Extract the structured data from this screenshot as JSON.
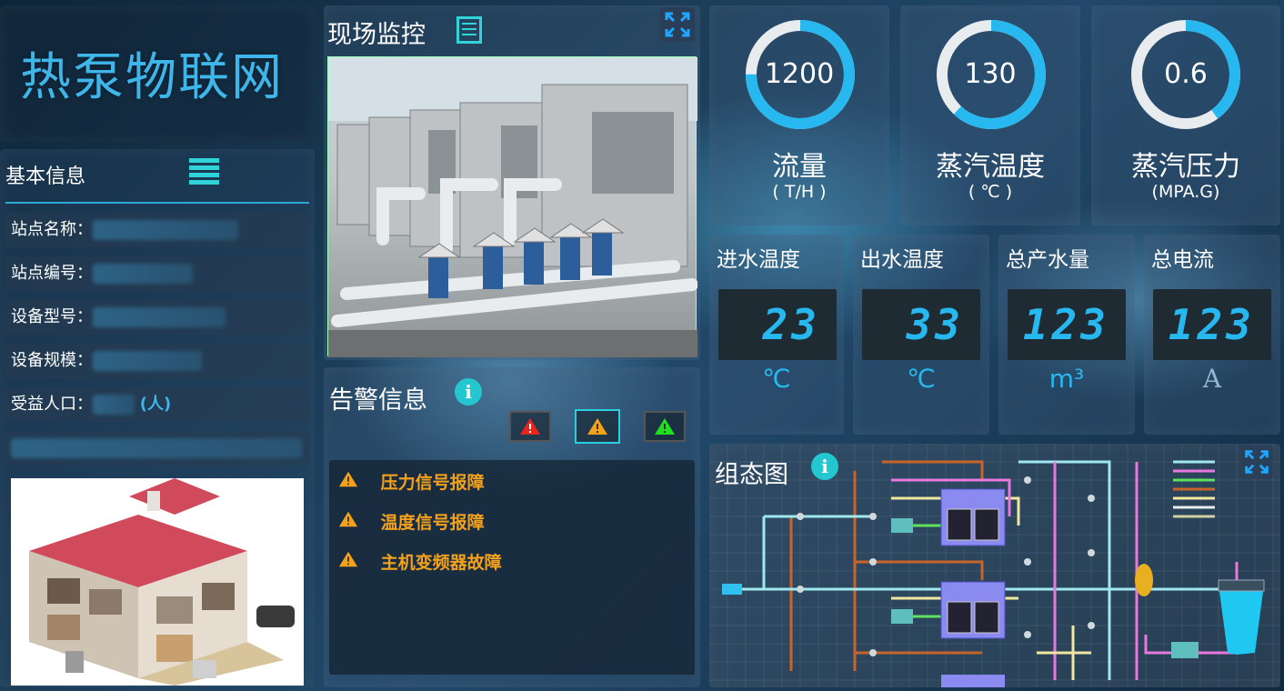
{
  "app_title": "热泵物联网",
  "basic_info": {
    "title": "基本信息",
    "rows": [
      {
        "label": "站点名称："
      },
      {
        "label": "站点编号："
      },
      {
        "label": "设备型号："
      },
      {
        "label": "设备规模："
      },
      {
        "label": "受益人口：",
        "suffix": "(人)"
      }
    ]
  },
  "monitor": {
    "title": "现场监控"
  },
  "alarm": {
    "title": "告警信息",
    "items": [
      "压力信号报障",
      "温度信号报障",
      "主机变频器故障"
    ],
    "colors": {
      "red": "#e8251c",
      "orange": "#f4a11b",
      "green": "#1ee01e"
    }
  },
  "gauges": [
    {
      "value": "1200",
      "label": "流量",
      "unit": "( T/H )",
      "fraction": 0.75
    },
    {
      "value": "130",
      "label": "蒸汽温度",
      "unit": "( ℃ )",
      "fraction": 0.62
    },
    {
      "value": "0.6",
      "label": "蒸汽压力",
      "unit": "(MPA.G)",
      "fraction": 0.4
    }
  ],
  "metrics": [
    {
      "title": "进水温度",
      "value": "23",
      "unit": "℃"
    },
    {
      "title": "出水温度",
      "value": "33",
      "unit": "℃"
    },
    {
      "title": "总产水量",
      "value": "123",
      "unit": "m³"
    },
    {
      "title": "总电流",
      "value": "123",
      "unit": "A"
    }
  ],
  "diagram": {
    "title": "组态图"
  },
  "accent": "#27b8f0",
  "brand": "#3fb6ea"
}
